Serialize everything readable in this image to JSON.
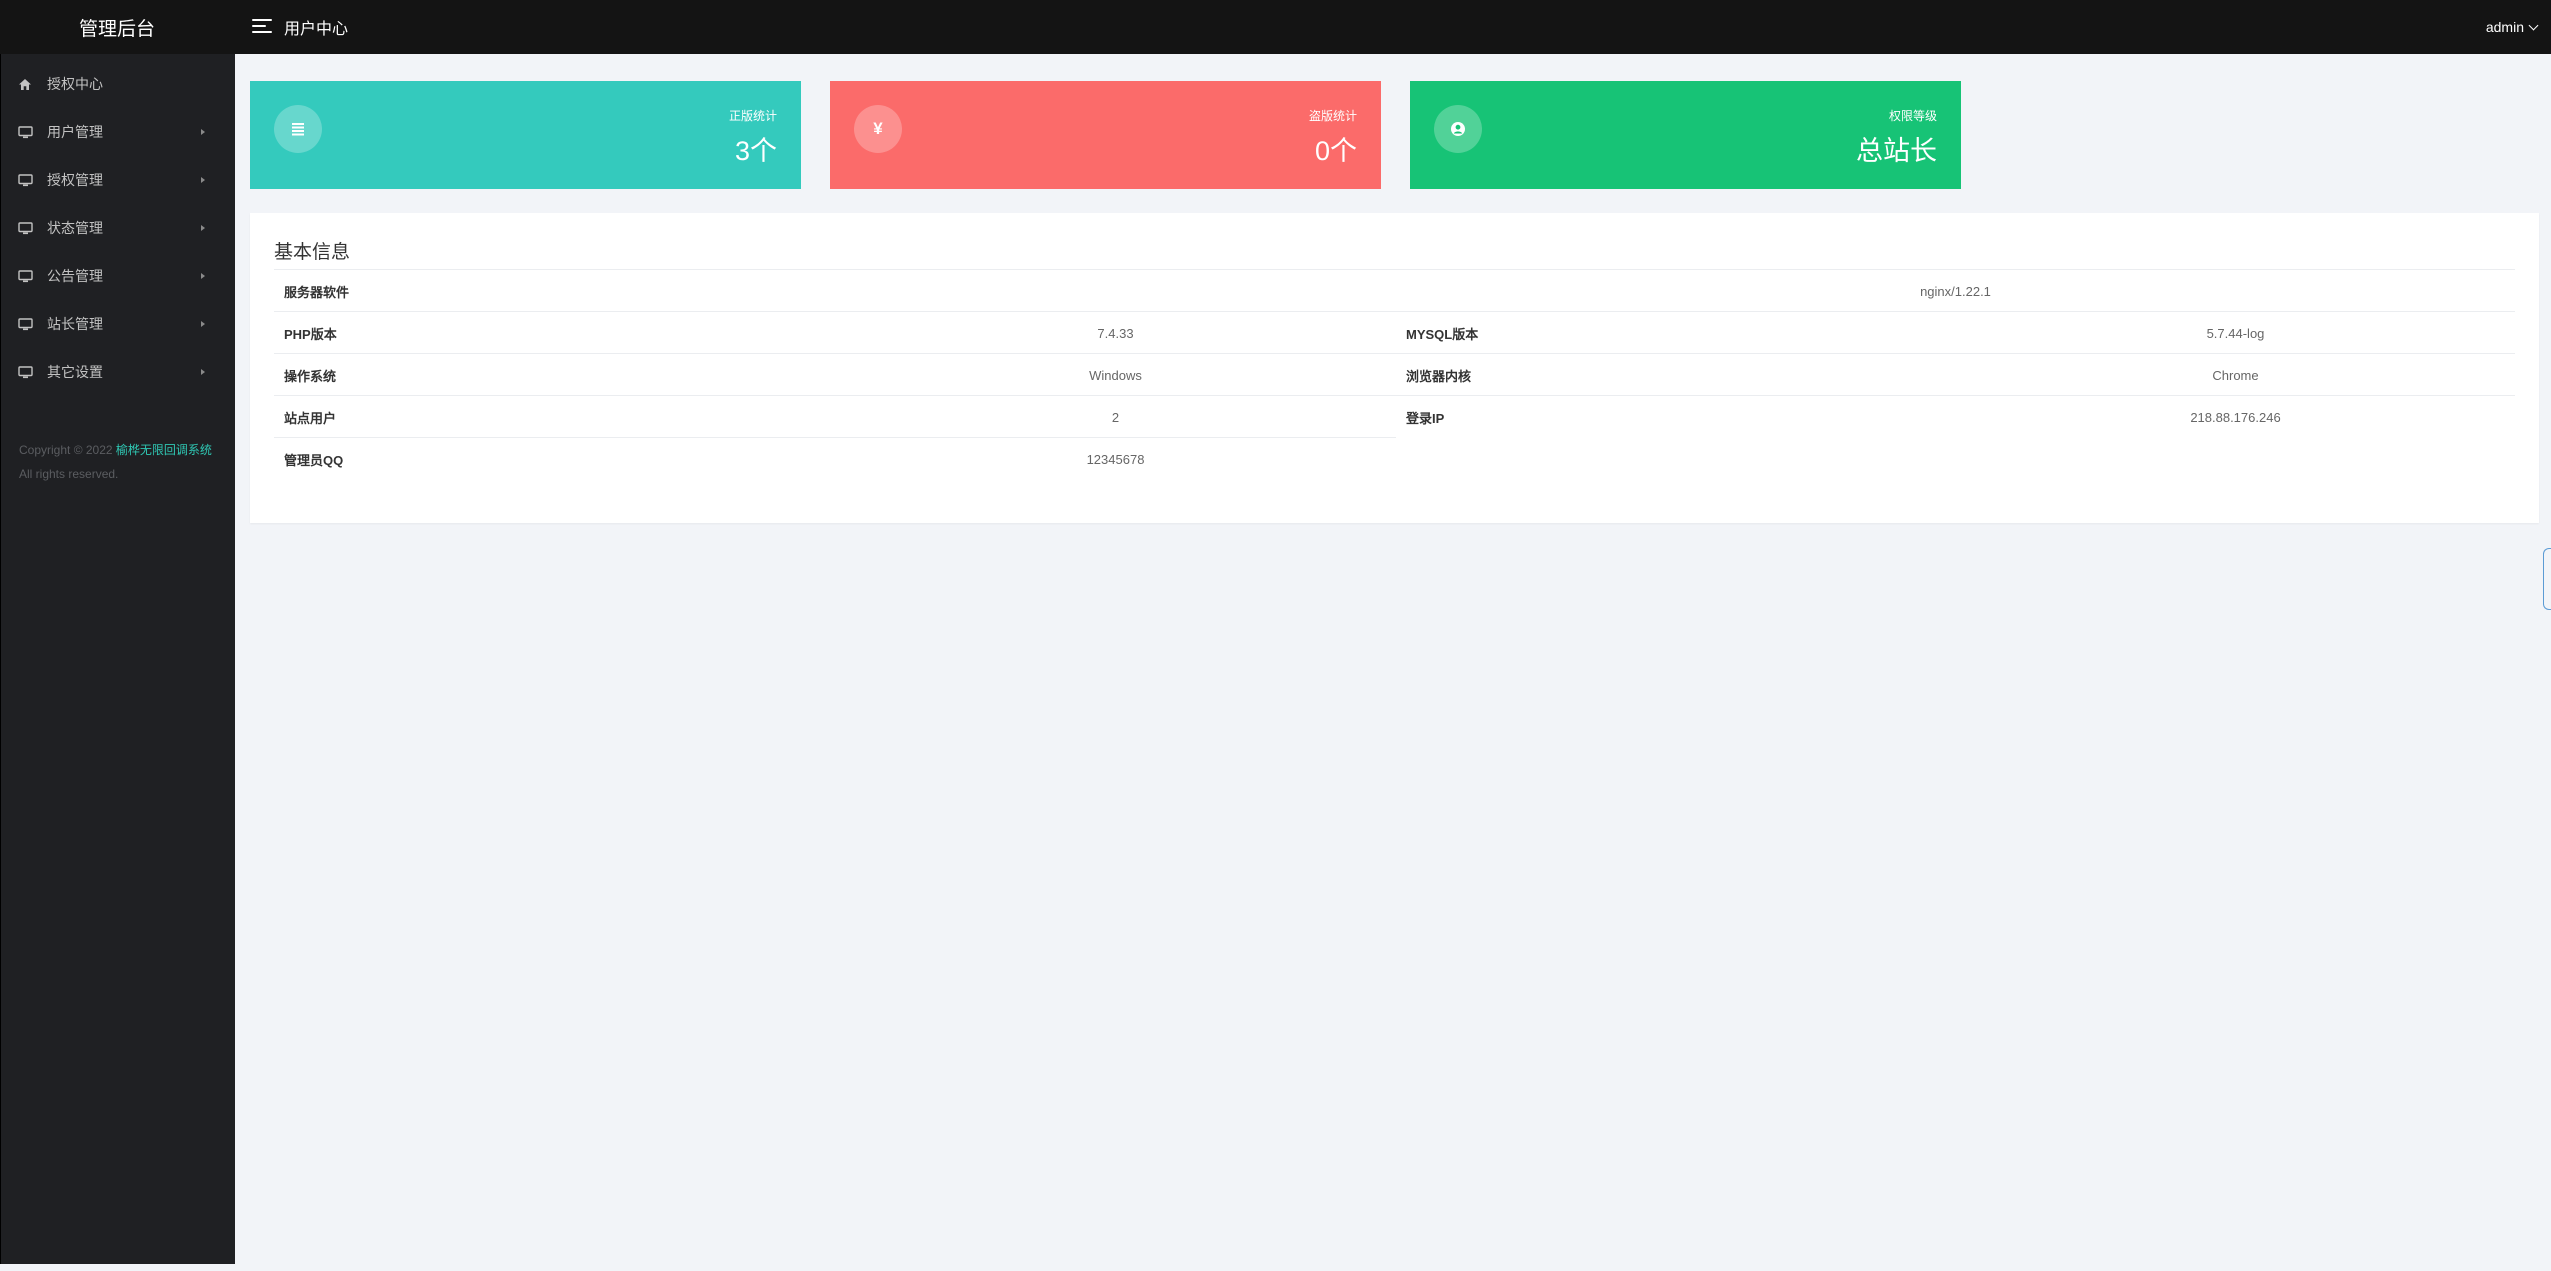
{
  "header": {
    "brand": "管理后台",
    "page_title": "用户中心",
    "user": "admin"
  },
  "sidebar": {
    "items": [
      {
        "label": "授权中心",
        "icon": "home-icon",
        "has_submenu": false
      },
      {
        "label": "用户管理",
        "icon": "monitor-icon",
        "has_submenu": true
      },
      {
        "label": "授权管理",
        "icon": "monitor-icon",
        "has_submenu": true
      },
      {
        "label": "状态管理",
        "icon": "monitor-icon",
        "has_submenu": true
      },
      {
        "label": "公告管理",
        "icon": "monitor-icon",
        "has_submenu": true
      },
      {
        "label": "站长管理",
        "icon": "monitor-icon",
        "has_submenu": true
      },
      {
        "label": "其它设置",
        "icon": "monitor-icon",
        "has_submenu": true
      }
    ],
    "copyright": {
      "prefix": "Copyright © 2022 ",
      "brand": "榆桦无限回调系统",
      "suffix": " All rights reserved."
    }
  },
  "stats": [
    {
      "label": "正版统计",
      "value": "3个",
      "icon": "list-icon",
      "color": "#34cabd"
    },
    {
      "label": "盗版统计",
      "value": "0个",
      "icon": "yen-icon",
      "color": "#fb6b6a"
    },
    {
      "label": "权限等级",
      "value": "总站长",
      "icon": "user-circle-icon",
      "color": "#17c376"
    }
  ],
  "info": {
    "title": "基本信息",
    "server_software": {
      "key": "服务器软件",
      "value": "nginx/1.22.1"
    },
    "php_version": {
      "key": "PHP版本",
      "value": "7.4.33"
    },
    "mysql_version": {
      "key": "MYSQL版本",
      "value": "5.7.44-log"
    },
    "os": {
      "key": "操作系统",
      "value": "Windows"
    },
    "browser_engine": {
      "key": "浏览器内核",
      "value": "Chrome"
    },
    "site_users": {
      "key": "站点用户",
      "value": "2"
    },
    "login_ip": {
      "key": "登录IP",
      "value": "218.88.176.246"
    },
    "admin_qq": {
      "key": "管理员QQ",
      "value": "12345678"
    }
  }
}
